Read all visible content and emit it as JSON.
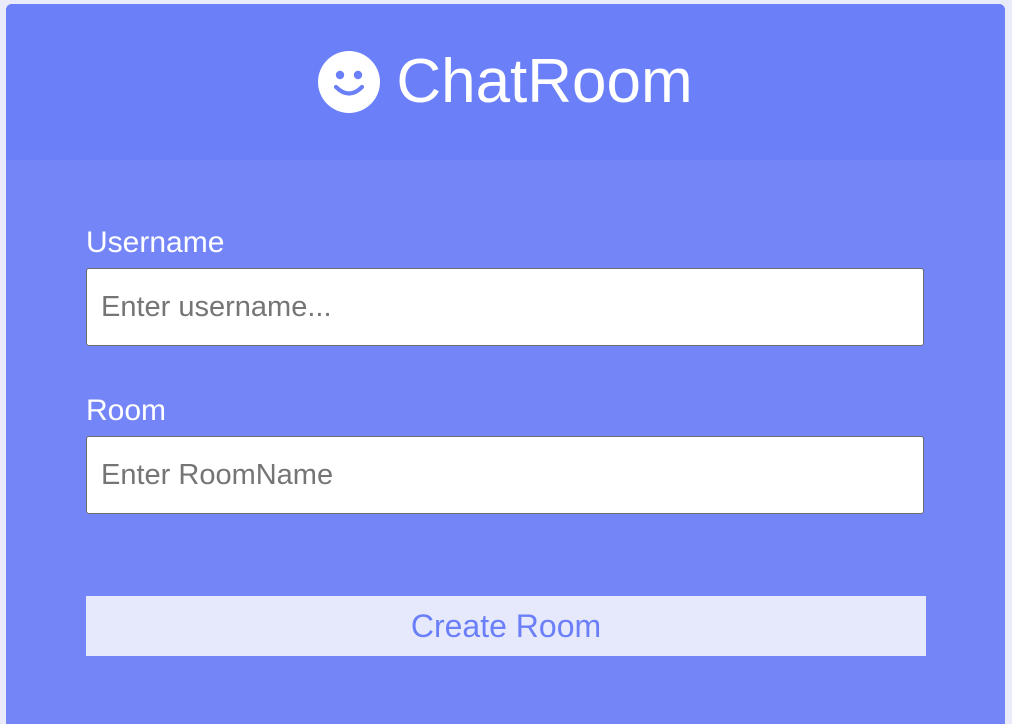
{
  "header": {
    "title": "ChatRoom",
    "logo_icon": "smiley-face-icon"
  },
  "form": {
    "username": {
      "label": "Username",
      "placeholder": "Enter username...",
      "value": ""
    },
    "room": {
      "label": "Room",
      "placeholder": "Enter RoomName",
      "value": ""
    },
    "submit_label": "Create Room"
  },
  "colors": {
    "page_background": "#e9ebfb",
    "card_background": "#7486f7",
    "header_background": "#6a7ff8",
    "button_background": "#e6e9fb",
    "button_text": "#6a7ff8",
    "text_light": "#ffffff"
  }
}
